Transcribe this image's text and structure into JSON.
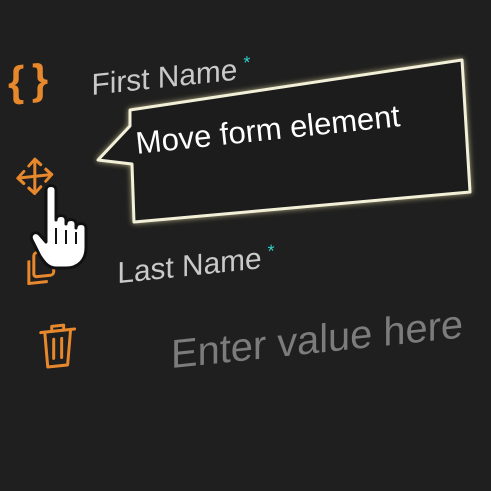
{
  "form": {
    "fields": [
      {
        "label": "First Name",
        "required_mark": "*"
      },
      {
        "label": "Last Name",
        "required_mark": "*",
        "placeholder": "Enter value here"
      }
    ]
  },
  "toolbar": {
    "icons": [
      "braces-icon",
      "move-icon",
      "copy-icon",
      "trash-icon"
    ]
  },
  "tooltip": {
    "text": "Move form element"
  },
  "cursor": "hand-pointer-icon",
  "colors": {
    "background": "#1f1f1f",
    "accent_orange": "#e8882d",
    "required_teal": "#2fd2c7",
    "label_text": "#c9c9c9",
    "placeholder_text": "#7c7c7c",
    "tooltip_border": "#f2f0d8"
  }
}
